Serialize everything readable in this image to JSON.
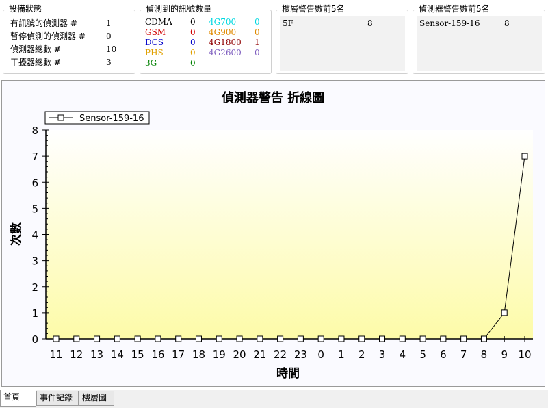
{
  "device_status": {
    "title": "設備狀態",
    "rows": [
      {
        "label": "有訊號的偵測器 #",
        "value": "1"
      },
      {
        "label": "暫停偵測的偵測器 #",
        "value": "0"
      },
      {
        "label": "偵測器總數 #",
        "value": "10"
      },
      {
        "label": "干擾器總數 #",
        "value": "3"
      }
    ]
  },
  "signal_counts": {
    "title": "偵測到的訊號數量",
    "rows": [
      [
        {
          "name": "CDMA",
          "value": "0",
          "color": "#000000"
        },
        {
          "name": "4G700",
          "value": "0",
          "color": "#00d8e0"
        }
      ],
      [
        {
          "name": "GSM",
          "value": "0",
          "color": "#d00000"
        },
        {
          "name": "4G900",
          "value": "0",
          "color": "#e08a00"
        }
      ],
      [
        {
          "name": "DCS",
          "value": "0",
          "color": "#0000c8"
        },
        {
          "name": "4G1800",
          "value": "1",
          "color": "#900000"
        }
      ],
      [
        {
          "name": "PHS",
          "value": "0",
          "color": "#e0a000"
        },
        {
          "name": "4G2600",
          "value": "0",
          "color": "#8060c0"
        }
      ],
      [
        {
          "name": "3G",
          "value": "0",
          "color": "#008000"
        }
      ]
    ]
  },
  "floor_top5": {
    "title": "樓層警告數前5名",
    "items": [
      {
        "name": "5F",
        "count": "8"
      }
    ]
  },
  "sensor_top5": {
    "title": "偵測器警告數前5名",
    "items": [
      {
        "name": "Sensor-159-16",
        "count": "8"
      }
    ]
  },
  "chart_data": {
    "type": "line",
    "title": "偵測器警告 折線圖",
    "xlabel": "時間",
    "ylabel": "次數",
    "categories": [
      "11",
      "12",
      "13",
      "14",
      "15",
      "16",
      "17",
      "18",
      "19",
      "20",
      "21",
      "22",
      "23",
      "0",
      "1",
      "2",
      "3",
      "4",
      "5",
      "6",
      "7",
      "8",
      "9",
      "10"
    ],
    "series": [
      {
        "name": "Sensor-159-16",
        "values": [
          0,
          0,
          0,
          0,
          0,
          0,
          0,
          0,
          0,
          0,
          0,
          0,
          0,
          0,
          0,
          0,
          0,
          0,
          0,
          0,
          0,
          0,
          1,
          7
        ],
        "color": "#000000",
        "marker": "square"
      }
    ],
    "ylim": [
      0,
      8
    ],
    "yticks": [
      0,
      1,
      2,
      3,
      4,
      5,
      6,
      7,
      8
    ],
    "legend": "top-left",
    "grid": false,
    "background_gradient": [
      "#ffffff",
      "#fdfba8"
    ]
  },
  "tabs": [
    {
      "label": "首頁",
      "active": true
    },
    {
      "label": "事件記錄",
      "active": false
    },
    {
      "label": "樓層圖",
      "active": false
    }
  ]
}
